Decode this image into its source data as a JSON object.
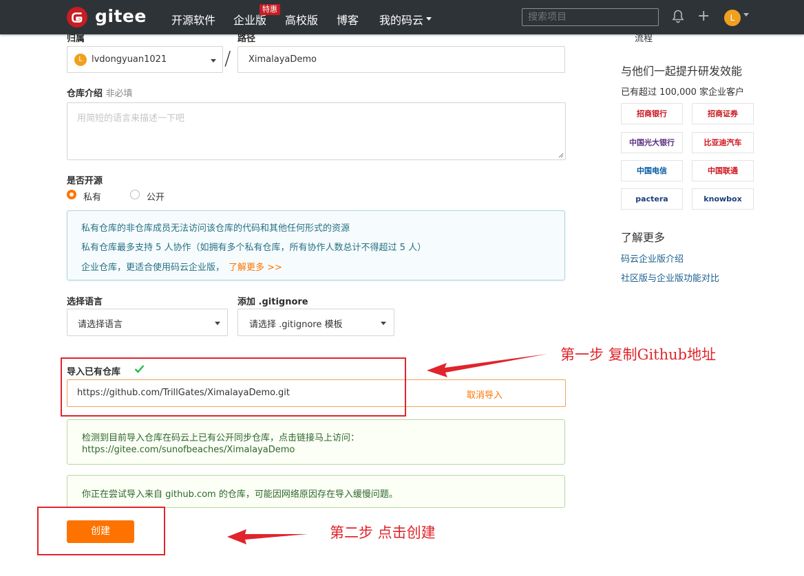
{
  "nav": {
    "logo_text": "gitee",
    "items": [
      "开源软件",
      "企业版",
      "高校版",
      "博客",
      "我的码云"
    ],
    "badge": "特惠",
    "search_placeholder": "搜索项目",
    "avatar_letter": "L"
  },
  "form": {
    "owner_label": "归属",
    "path_label": "路径",
    "owner_value": "lvdongyuan1021",
    "owner_avatar_letter": "L",
    "separator": "/",
    "path_value": "XimalayaDemo",
    "desc_label": "仓库介绍",
    "desc_optional": "非必填",
    "desc_placeholder": "用简短的语言来描述一下吧",
    "open_label": "是否开源",
    "private_label": "私有",
    "public_label": "公开",
    "info_lines": [
      "私有仓库的非仓库成员无法访问该仓库的代码和其他任何形式的资源",
      "私有仓库最多支持 5 人协作（如拥有多个私有仓库，所有协作人数总计不得超过 5 人）",
      "企业仓库，更适合使用码云企业版，"
    ],
    "info_link": "了解更多 >>",
    "lang_label": "选择语言",
    "lang_value": "请选择语言",
    "gitignore_label": "添加 .gitignore",
    "gitignore_value": "请选择 .gitignore 模板",
    "import_label": "导入已有仓库",
    "import_value": "https://github.com/TrillGates/XimalayaDemo.git",
    "cancel_import": "取消导入",
    "detect_line1": "检测到目前导入仓库在码云上已有公开同步仓库，点击链接马上访问：",
    "detect_line2": "https://gitee.com/sunofbeaches/XimalayaDemo",
    "slow_warning": "你正在尝试导入来自 github.com 的仓库，可能因网络原因存在导入缓慢问题。",
    "create_button": "创建"
  },
  "sidebar": {
    "flow_text": "流程",
    "promo_title": "与他们一起提升研发效能",
    "promo_sub": "已有超过 100,000 家企业客户",
    "partners": [
      "招商银行",
      "招商证券",
      "中国光大银行",
      "比亚迪汽车",
      "中国电信",
      "中国联通",
      "pactera",
      "knowbox"
    ],
    "more_title": "了解更多",
    "links": [
      "码云企业版介绍",
      "社区版与企业版功能对比"
    ]
  },
  "annotations": {
    "step1": "第一步  复制Github地址",
    "step2": "第二步  点击创建"
  },
  "colors": {
    "nav_bg": "#2e3338",
    "accent": "#fe7300",
    "brand_red": "#c71d23",
    "annotation_red": "#e0242b"
  }
}
